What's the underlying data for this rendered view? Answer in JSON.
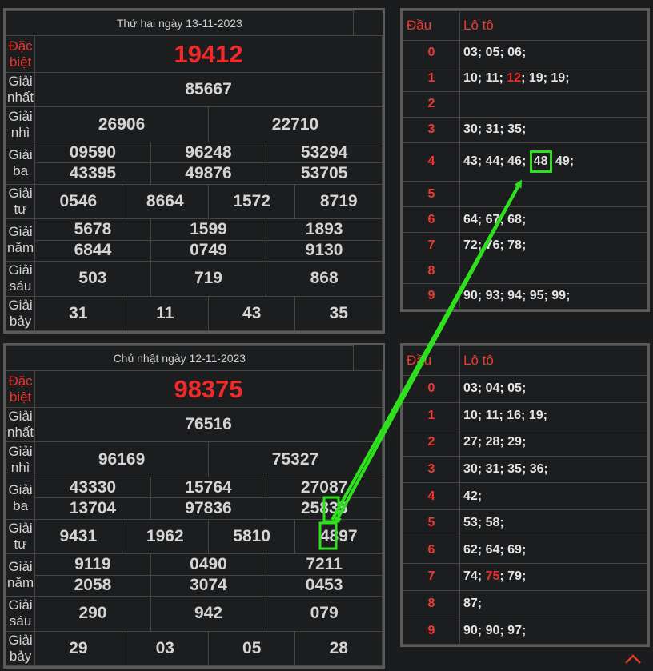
{
  "top_results": {
    "title": "Thứ hai ngày 13-11-2023",
    "special_label": "Đặc biệt",
    "special": "19412",
    "first_label": "Giải nhất",
    "first": "85667",
    "second_label": "Giải nhì",
    "second": [
      "26906",
      "22710"
    ],
    "third_label": "Giải ba",
    "third": [
      "09590",
      "96248",
      "53294",
      "43395",
      "49876",
      "53705"
    ],
    "fourth_label": "Giải tư",
    "fourth": [
      "0546",
      "8664",
      "1572",
      "8719"
    ],
    "fifth_label": "Giải năm",
    "fifth": [
      "5678",
      "1599",
      "1893",
      "6844",
      "0749",
      "9130"
    ],
    "sixth_label": "Giải sáu",
    "sixth": [
      "503",
      "719",
      "868"
    ],
    "seventh_label": "Giải bảy",
    "seventh": [
      "31",
      "11",
      "43",
      "35"
    ]
  },
  "bottom_results": {
    "title": "Chủ nhật ngày 12-11-2023",
    "special_label": "Đặc biệt",
    "special": "98375",
    "first_label": "Giải nhất",
    "first": "76516",
    "second_label": "Giải nhì",
    "second": [
      "96169",
      "75327"
    ],
    "third_label": "Giải ba",
    "third": [
      "43330",
      "15764",
      "27087",
      "13704",
      "97836",
      "25835"
    ],
    "fourth_label": "Giải tư",
    "fourth": [
      "9431",
      "1962",
      "5810",
      "4897"
    ],
    "fifth_label": "Giải năm",
    "fifth": [
      "9119",
      "0490",
      "7211",
      "2058",
      "3074",
      "0453"
    ],
    "sixth_label": "Giải sáu",
    "sixth": [
      "290",
      "942",
      "079"
    ],
    "seventh_label": "Giải bảy",
    "seventh": [
      "29",
      "03",
      "05",
      "28"
    ]
  },
  "top_loto": {
    "header_dau": "Đầu",
    "header_loto": "Lô tô",
    "rows": [
      {
        "dau": "0",
        "text": "03; 05; 06;"
      },
      {
        "dau": "1",
        "pre": "10; 11; ",
        "red": "12",
        "post": "; 19; 19;"
      },
      {
        "dau": "2",
        "text": ""
      },
      {
        "dau": "3",
        "text": "30; 31; 35;"
      },
      {
        "dau": "4",
        "pre": "43; 44; 46;",
        "boxed": "48",
        "post": "49;"
      },
      {
        "dau": "5",
        "text": ""
      },
      {
        "dau": "6",
        "text": "64; 67; 68;"
      },
      {
        "dau": "7",
        "text": "72; 76; 78;"
      },
      {
        "dau": "8",
        "text": ""
      },
      {
        "dau": "9",
        "text": "90; 93; 94; 95; 99;"
      }
    ]
  },
  "bottom_loto": {
    "header_dau": "Đầu",
    "header_loto": "Lô tô",
    "rows": [
      {
        "dau": "0",
        "text": "03; 04; 05;"
      },
      {
        "dau": "1",
        "text": "10; 11; 16; 19;"
      },
      {
        "dau": "2",
        "text": "27; 28; 29;"
      },
      {
        "dau": "3",
        "text": "30; 31; 35; 36;"
      },
      {
        "dau": "4",
        "text": "42;"
      },
      {
        "dau": "5",
        "text": "53; 58;"
      },
      {
        "dau": "6",
        "text": "62; 64; 69;"
      },
      {
        "dau": "7",
        "pre": "74; ",
        "red": "75",
        "post": "; 79;"
      },
      {
        "dau": "8",
        "text": "87;"
      },
      {
        "dau": "9",
        "text": "90; 90; 97;"
      }
    ]
  },
  "colors": {
    "accent_red": "#ef2b2b",
    "highlight_green": "#2fe01f",
    "panel_border": "#5a5a58"
  },
  "icons": {
    "scroll_top": "chevron-up-icon",
    "annotation": "green-arrow"
  }
}
